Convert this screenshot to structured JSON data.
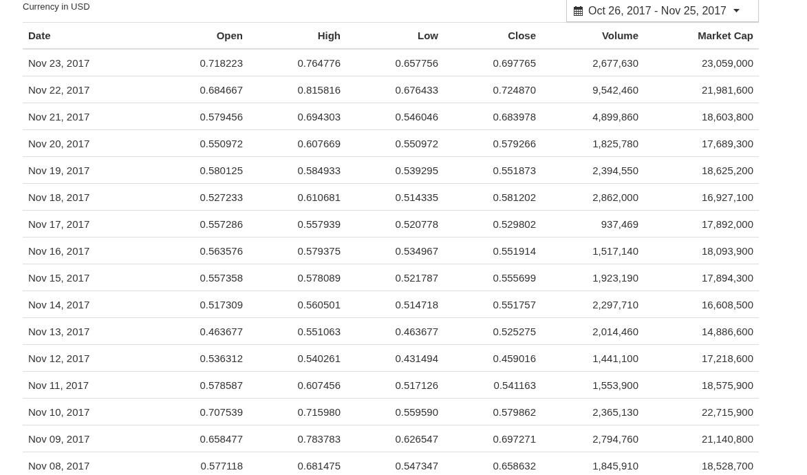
{
  "currency_note": "Currency in USD",
  "date_range": {
    "label": "Oct 26, 2017 - Nov 25, 2017"
  },
  "table": {
    "columns": [
      "Date",
      "Open",
      "High",
      "Low",
      "Close",
      "Volume",
      "Market Cap"
    ],
    "rows": [
      [
        "Nov 23, 2017",
        "0.718223",
        "0.764776",
        "0.657756",
        "0.697765",
        "2,677,630",
        "23,059,000"
      ],
      [
        "Nov 22, 2017",
        "0.684667",
        "0.815816",
        "0.676433",
        "0.724870",
        "9,542,460",
        "21,981,600"
      ],
      [
        "Nov 21, 2017",
        "0.579456",
        "0.694303",
        "0.546046",
        "0.683978",
        "4,899,860",
        "18,603,800"
      ],
      [
        "Nov 20, 2017",
        "0.550972",
        "0.607669",
        "0.550972",
        "0.579266",
        "1,825,780",
        "17,689,300"
      ],
      [
        "Nov 19, 2017",
        "0.580125",
        "0.584933",
        "0.539295",
        "0.551873",
        "2,394,550",
        "18,625,200"
      ],
      [
        "Nov 18, 2017",
        "0.527233",
        "0.610681",
        "0.514335",
        "0.581202",
        "2,862,000",
        "16,927,100"
      ],
      [
        "Nov 17, 2017",
        "0.557286",
        "0.557939",
        "0.520778",
        "0.529802",
        "937,469",
        "17,892,000"
      ],
      [
        "Nov 16, 2017",
        "0.563576",
        "0.579375",
        "0.534967",
        "0.551914",
        "1,517,140",
        "18,093,900"
      ],
      [
        "Nov 15, 2017",
        "0.557358",
        "0.578089",
        "0.521787",
        "0.555699",
        "1,923,190",
        "17,894,300"
      ],
      [
        "Nov 14, 2017",
        "0.517309",
        "0.560501",
        "0.514718",
        "0.551757",
        "2,297,710",
        "16,608,500"
      ],
      [
        "Nov 13, 2017",
        "0.463677",
        "0.551063",
        "0.463677",
        "0.525275",
        "2,014,460",
        "14,886,600"
      ],
      [
        "Nov 12, 2017",
        "0.536312",
        "0.540261",
        "0.431494",
        "0.459016",
        "1,441,100",
        "17,218,600"
      ],
      [
        "Nov 11, 2017",
        "0.578587",
        "0.607456",
        "0.517126",
        "0.541163",
        "1,553,900",
        "18,575,900"
      ],
      [
        "Nov 10, 2017",
        "0.707539",
        "0.715980",
        "0.559590",
        "0.579862",
        "2,365,130",
        "22,715,900"
      ],
      [
        "Nov 09, 2017",
        "0.658477",
        "0.783783",
        "0.626547",
        "0.697271",
        "2,794,760",
        "21,140,800"
      ],
      [
        "Nov 08, 2017",
        "0.577118",
        "0.681475",
        "0.547347",
        "0.658632",
        "1,845,910",
        "18,528,700"
      ]
    ]
  }
}
